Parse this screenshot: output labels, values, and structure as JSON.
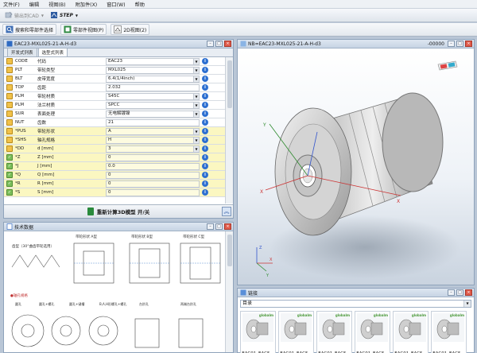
{
  "menu": [
    "文件(F)",
    "编辑",
    "视图(B)",
    "附加件(X)",
    "窗口(W)",
    "帮助"
  ],
  "toolbar1": {
    "export_cad": "输出到CAD",
    "step": "STEP"
  },
  "toolbar2": {
    "search": "搜索和零部件选择",
    "part_view": "零部件视图(P)",
    "view_2d": "2D视图(2)"
  },
  "params_window": {
    "title": "EAC23-MXL025-21-A-H-d3",
    "tabs": [
      "开发式列表",
      "选型式列表"
    ],
    "rows": [
      {
        "check": "orange",
        "name": "CODE",
        "desc": "代码",
        "value": "EAC23",
        "dd": true,
        "bg": "white"
      },
      {
        "check": "orange",
        "name": "PLT",
        "desc": "带轮类型",
        "value": "MXL025",
        "dd": true,
        "bg": "white"
      },
      {
        "check": "orange",
        "name": "BLT",
        "desc": "皮带宽度",
        "value": "6.4(1/4inch)",
        "dd": true,
        "bg": "white"
      },
      {
        "check": "orange",
        "name": "TOP",
        "desc": "齿距",
        "value": "2.032",
        "dd": false,
        "bg": "white"
      },
      {
        "check": "orange",
        "name": "PLM",
        "desc": "带轮材质",
        "value": "S45C",
        "dd": true,
        "bg": "white"
      },
      {
        "check": "orange",
        "name": "PLM",
        "desc": "法兰材质",
        "value": "SPCC",
        "dd": true,
        "bg": "white"
      },
      {
        "check": "orange",
        "name": "SUR",
        "desc": "表面处理",
        "value": "无电解镀镍",
        "dd": true,
        "bg": "white"
      },
      {
        "check": "orange",
        "name": "NUT",
        "desc": "齿数",
        "value": "21",
        "dd": false,
        "bg": "white"
      },
      {
        "check": "orange",
        "name": "*PUS",
        "desc": "带轮形状",
        "value": "A",
        "dd": true,
        "bg": "yellow"
      },
      {
        "check": "orange",
        "name": "*SHS",
        "desc": "轴孔规格",
        "value": "H",
        "dd": true,
        "bg": "yellow"
      },
      {
        "check": "orange",
        "name": "*DD",
        "desc": "d [mm]",
        "value": "3",
        "dd": true,
        "bg": "yellow"
      },
      {
        "check": "green",
        "name": "*Z",
        "desc": "Z [mm]",
        "value": "0",
        "dd": false,
        "bg": "yellow"
      },
      {
        "check": "green",
        "name": "*J",
        "desc": "J [mm]",
        "value": "0.0",
        "dd": false,
        "bg": "yellow"
      },
      {
        "check": "green",
        "name": "*Q",
        "desc": "Q [mm]",
        "value": "0",
        "dd": false,
        "bg": "yellow"
      },
      {
        "check": "green",
        "name": "*R",
        "desc": "R [mm]",
        "value": "0",
        "dd": false,
        "bg": "yellow"
      },
      {
        "check": "green",
        "name": "*S",
        "desc": "S [mm]",
        "value": "0",
        "dd": false,
        "bg": "yellow"
      }
    ],
    "recalc": "重新计算3D模型 开/关"
  },
  "view_window": {
    "title": "NB=EAC23-MXL025-21-A-H-d3",
    "counter": "-00000"
  },
  "tech_window": {
    "title": "技术数据",
    "labels": [
      "带轮形状 A型",
      "带轮形状 B型",
      "带轮形状 C型"
    ],
    "note_left": "齿型（30°曲齿带轮选用）",
    "note_bottom": "●轴孔规格",
    "opts": [
      "圆孔",
      "圆孔+螺孔",
      "圆孔+键槽",
      "B,A,H形螺孔+螺孔",
      "F,J,H形螺孔+键槽",
      "台阶孔",
      "两端台阶孔"
    ]
  },
  "catalog_window": {
    "title": "链接",
    "select": "目录",
    "items": [
      "EAC01_EAC5...",
      "EAC01_EAC5...",
      "EAC01_EAC5...",
      "EAC01_EAC5...",
      "EAC01_EAC5...",
      "EAC01_EAC5..."
    ],
    "brand": "globalm"
  }
}
